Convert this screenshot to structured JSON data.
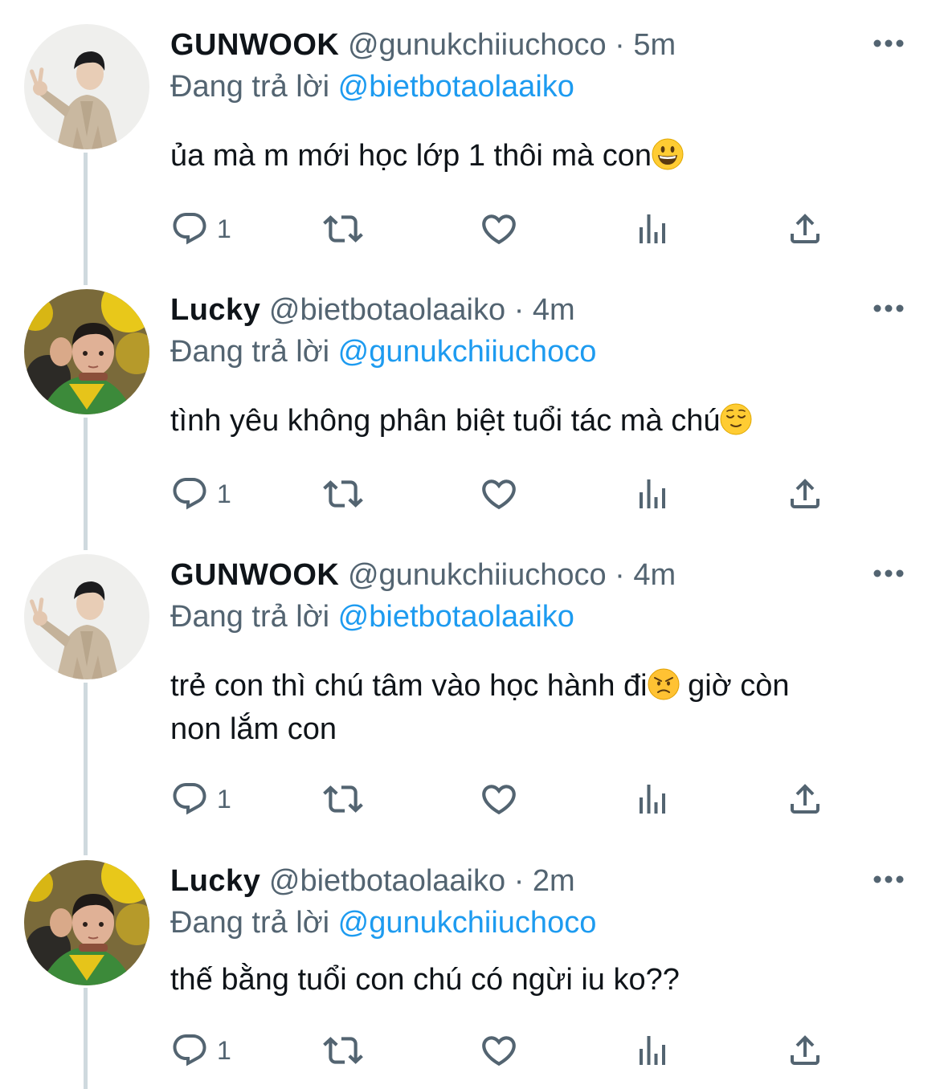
{
  "colors": {
    "text": "#0f1419",
    "secondary": "#536471",
    "link": "#1d9bf0",
    "thread_line": "#cfd9de"
  },
  "tweets": [
    {
      "name": "GUNWOOK",
      "handle": "@gunukchiiuchoco",
      "dot": "·",
      "time": "5m",
      "replying_prefix": "Đang trả lời",
      "replying_to": "@bietbotaolaaiko",
      "text_lines": [
        "ủa mà m mới học lớp 1 thôi mà con"
      ],
      "emoji": "grinning-face",
      "reply_count": "1",
      "avatar": "avatar-gunwook"
    },
    {
      "name": "Lucky",
      "handle": "@bietbotaolaaiko",
      "dot": "·",
      "time": "4m",
      "replying_prefix": "Đang trả lời",
      "replying_to": "@gunukchiiuchoco",
      "text_lines": [
        "tình yêu không phân biệt tuổi tác mà chú"
      ],
      "emoji": "relieved-face",
      "reply_count": "1",
      "avatar": "avatar-lucky"
    },
    {
      "name": "GUNWOOK",
      "handle": "@gunukchiiuchoco",
      "dot": "·",
      "time": "4m",
      "replying_prefix": "Đang trả lời",
      "replying_to": "@bietbotaolaaiko",
      "text_lines": [
        "trẻ con thì chú tâm vào học hành đi",
        " giờ còn",
        "non lắm con"
      ],
      "emoji": "angry-face",
      "reply_count": "1",
      "avatar": "avatar-gunwook"
    },
    {
      "name": "Lucky",
      "handle": "@bietbotaolaaiko",
      "dot": "·",
      "time": "2m",
      "replying_prefix": "Đang trả lời",
      "replying_to": "@gunukchiiuchoco",
      "text_lines": [
        "thế bằng tuổi con chú có ngừi iu ko??"
      ],
      "emoji": "",
      "reply_count": "1",
      "avatar": "avatar-lucky"
    }
  ],
  "icons": [
    "reply-icon",
    "retweet-icon",
    "like-icon",
    "analytics-icon",
    "share-icon",
    "more-icon"
  ]
}
